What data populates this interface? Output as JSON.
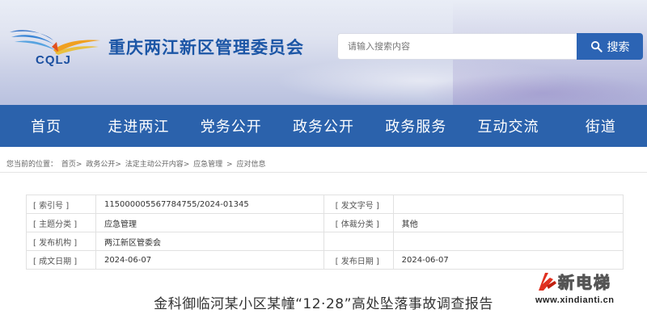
{
  "header": {
    "logo_text": "CQLJ",
    "site_title": "重庆两江新区管理委员会",
    "search_placeholder": "请输入搜索内容",
    "search_button": "搜索",
    "brand_color": "#2b62ac"
  },
  "nav": {
    "items": [
      "首页",
      "走进两江",
      "党务公开",
      "政务公开",
      "政务服务",
      "互动交流",
      "街道"
    ]
  },
  "breadcrumb": {
    "prefix": "您当前的位置：",
    "items": [
      "首页>",
      "政务公开>",
      "法定主动公开内容>",
      "应急管理",
      ">",
      "应对信息"
    ]
  },
  "info": {
    "rows": [
      {
        "label1": "[ 索引号 ]",
        "value1": "115000005567784755/2024-01345",
        "label2": "[ 发文字号 ]",
        "value2": ""
      },
      {
        "label1": "[ 主题分类 ]",
        "value1": "应急管理",
        "label2": "[ 体裁分类 ]",
        "value2": "其他"
      },
      {
        "label1": "[ 发布机构 ]",
        "value1": "两江新区管委会",
        "label2": "",
        "value2": ""
      },
      {
        "label1": "[ 成文日期 ]",
        "value1": "2024-06-07",
        "label2": "[ 发布日期 ]",
        "value2": "2024-06-07"
      }
    ]
  },
  "document": {
    "title": "金科御临河某小区某幢“12·28”高处坠落事故调查报告"
  },
  "watermark": {
    "name": "新电梯",
    "url": "www.xindianti.cn"
  }
}
